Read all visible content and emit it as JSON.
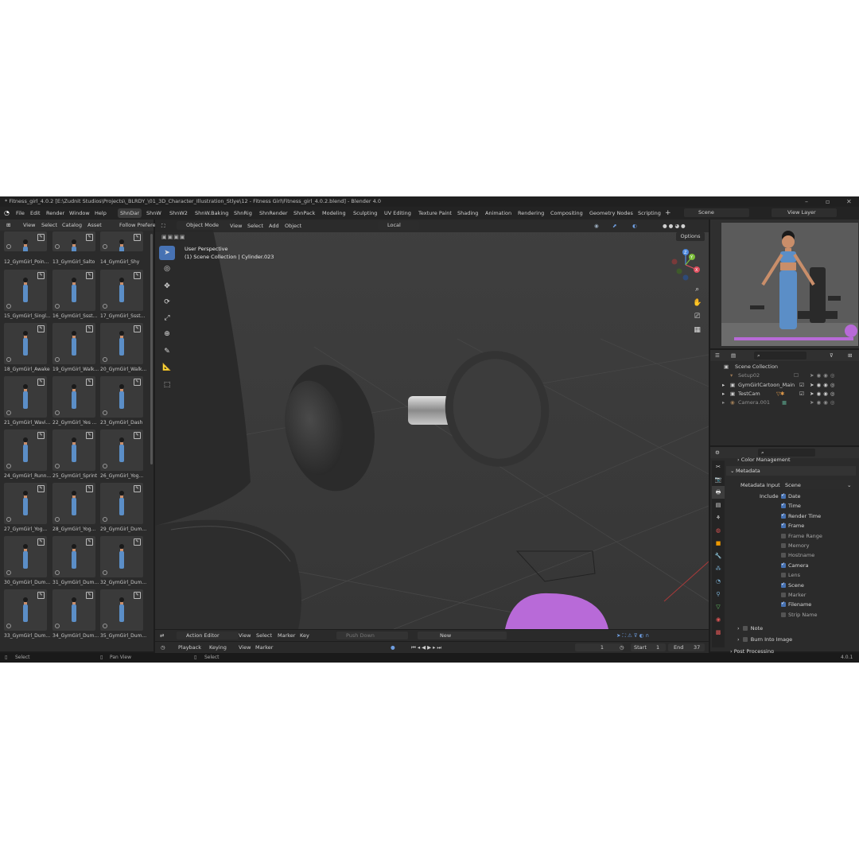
{
  "window": {
    "title": "* Fitness_girl_4.0.2 [E:\\Zudnit Studios\\Projects\\_BLRDY_\\01_3D_Character_Illustration_Stlye\\12 - Fitness Girl\\Fitness_girl_4.0.2.blend] - Blender 4.0"
  },
  "menu": [
    "File",
    "Edit",
    "Render",
    "Window",
    "Help"
  ],
  "workspaces": [
    "ShnDar",
    "ShnW",
    "ShnW2",
    "ShnW.Baking",
    "ShnRig",
    "ShnRender",
    "ShnPack",
    "Modeling",
    "Sculpting",
    "UV Editing",
    "Texture Paint",
    "Shading",
    "Animation",
    "Rendering",
    "Compositing",
    "Geometry Nodes",
    "Scripting"
  ],
  "scene_selector": {
    "scene": "Scene",
    "view_layer": "View Layer"
  },
  "asset_browser": {
    "header": [
      "View",
      "Select",
      "Catalog",
      "Asset",
      "Follow Prefere"
    ],
    "rows": [
      [
        "12_GymGirl_Poin...",
        "13_GymGirl_Salto",
        "14_GymGirl_Shy"
      ],
      [
        "15_GymGirl_Singl...",
        "16_GymGirl_Ssst...",
        "17_GymGirl_Ssst..."
      ],
      [
        "18_GymGirl_Awake",
        "19_GymGirl_Walk...",
        "20_GymGirl_Walk..."
      ],
      [
        "21_GymGirl_Wavi...",
        "22_GymGirl_Yes ...",
        "23_GymGirl_Dash"
      ],
      [
        "24_GymGirl_Runn...",
        "25_GymGirl_Sprint",
        "26_GymGirl_Yog..."
      ],
      [
        "27_GymGirl_Yog...",
        "28_GymGirl_Yog...",
        "29_GymGirl_Dum..."
      ],
      [
        "30_GymGirl_Dum...",
        "31_GymGirl_Dum...",
        "32_GymGirl_Dum..."
      ],
      [
        "33_GymGirl_Dum...",
        "34_GymGirl_Dum...",
        "35_GymGirl_Dum..."
      ]
    ]
  },
  "viewport": {
    "mode": "Object Mode",
    "menu": [
      "View",
      "Select",
      "Add",
      "Object"
    ],
    "orientation": "Local",
    "options": "Options",
    "overlay_line1": "User Perspective",
    "overlay_line2": "(1) Scene Collection | Cylinder.023",
    "gizmo_axes": [
      "Z",
      "Y",
      "X"
    ]
  },
  "outliner": {
    "root": "Scene Collection",
    "items": [
      "Setup02",
      "GymGirlCartoon_Main",
      "TestCam",
      "Camera.001"
    ]
  },
  "properties": {
    "color_management": "Color Management",
    "metadata": "Metadata",
    "metadata_input_label": "Metadata Input",
    "metadata_input_value": "Scene",
    "include_label": "Include",
    "fields": [
      {
        "label": "Date",
        "checked": true
      },
      {
        "label": "Time",
        "checked": true
      },
      {
        "label": "Render Time",
        "checked": true
      },
      {
        "label": "Frame",
        "checked": true
      },
      {
        "label": "Frame Range",
        "checked": false
      },
      {
        "label": "Memory",
        "checked": false
      },
      {
        "label": "Hostname",
        "checked": false
      },
      {
        "label": "Camera",
        "checked": true
      },
      {
        "label": "Lens",
        "checked": false
      },
      {
        "label": "Scene",
        "checked": true
      },
      {
        "label": "Marker",
        "checked": false
      },
      {
        "label": "Filename",
        "checked": true
      },
      {
        "label": "Strip Name",
        "checked": false
      }
    ],
    "note": "Note",
    "burn_into_image": "Burn Into Image",
    "post_processing": "Post Processing"
  },
  "action_editor": {
    "mode": "Action Editor",
    "menu": [
      "View",
      "Select",
      "Marker",
      "Key"
    ],
    "push_down": "Push Down",
    "stash": "Stash",
    "new": "New"
  },
  "timeline": {
    "menu": [
      "Playback",
      "Keying",
      "View",
      "Marker"
    ],
    "current_frame": "1",
    "start_label": "Start",
    "start": "1",
    "end_label": "End",
    "end": "37"
  },
  "statusbar": {
    "select": "Select",
    "pan": "Pan View",
    "select2": "Select",
    "version": "4.0.1"
  },
  "colors": {
    "accent": "#4772b3",
    "background": "#1d1d1d",
    "panel": "#2b2b2b",
    "viewport": "#3a3a3a",
    "mat_purple": "#b86ad8"
  }
}
